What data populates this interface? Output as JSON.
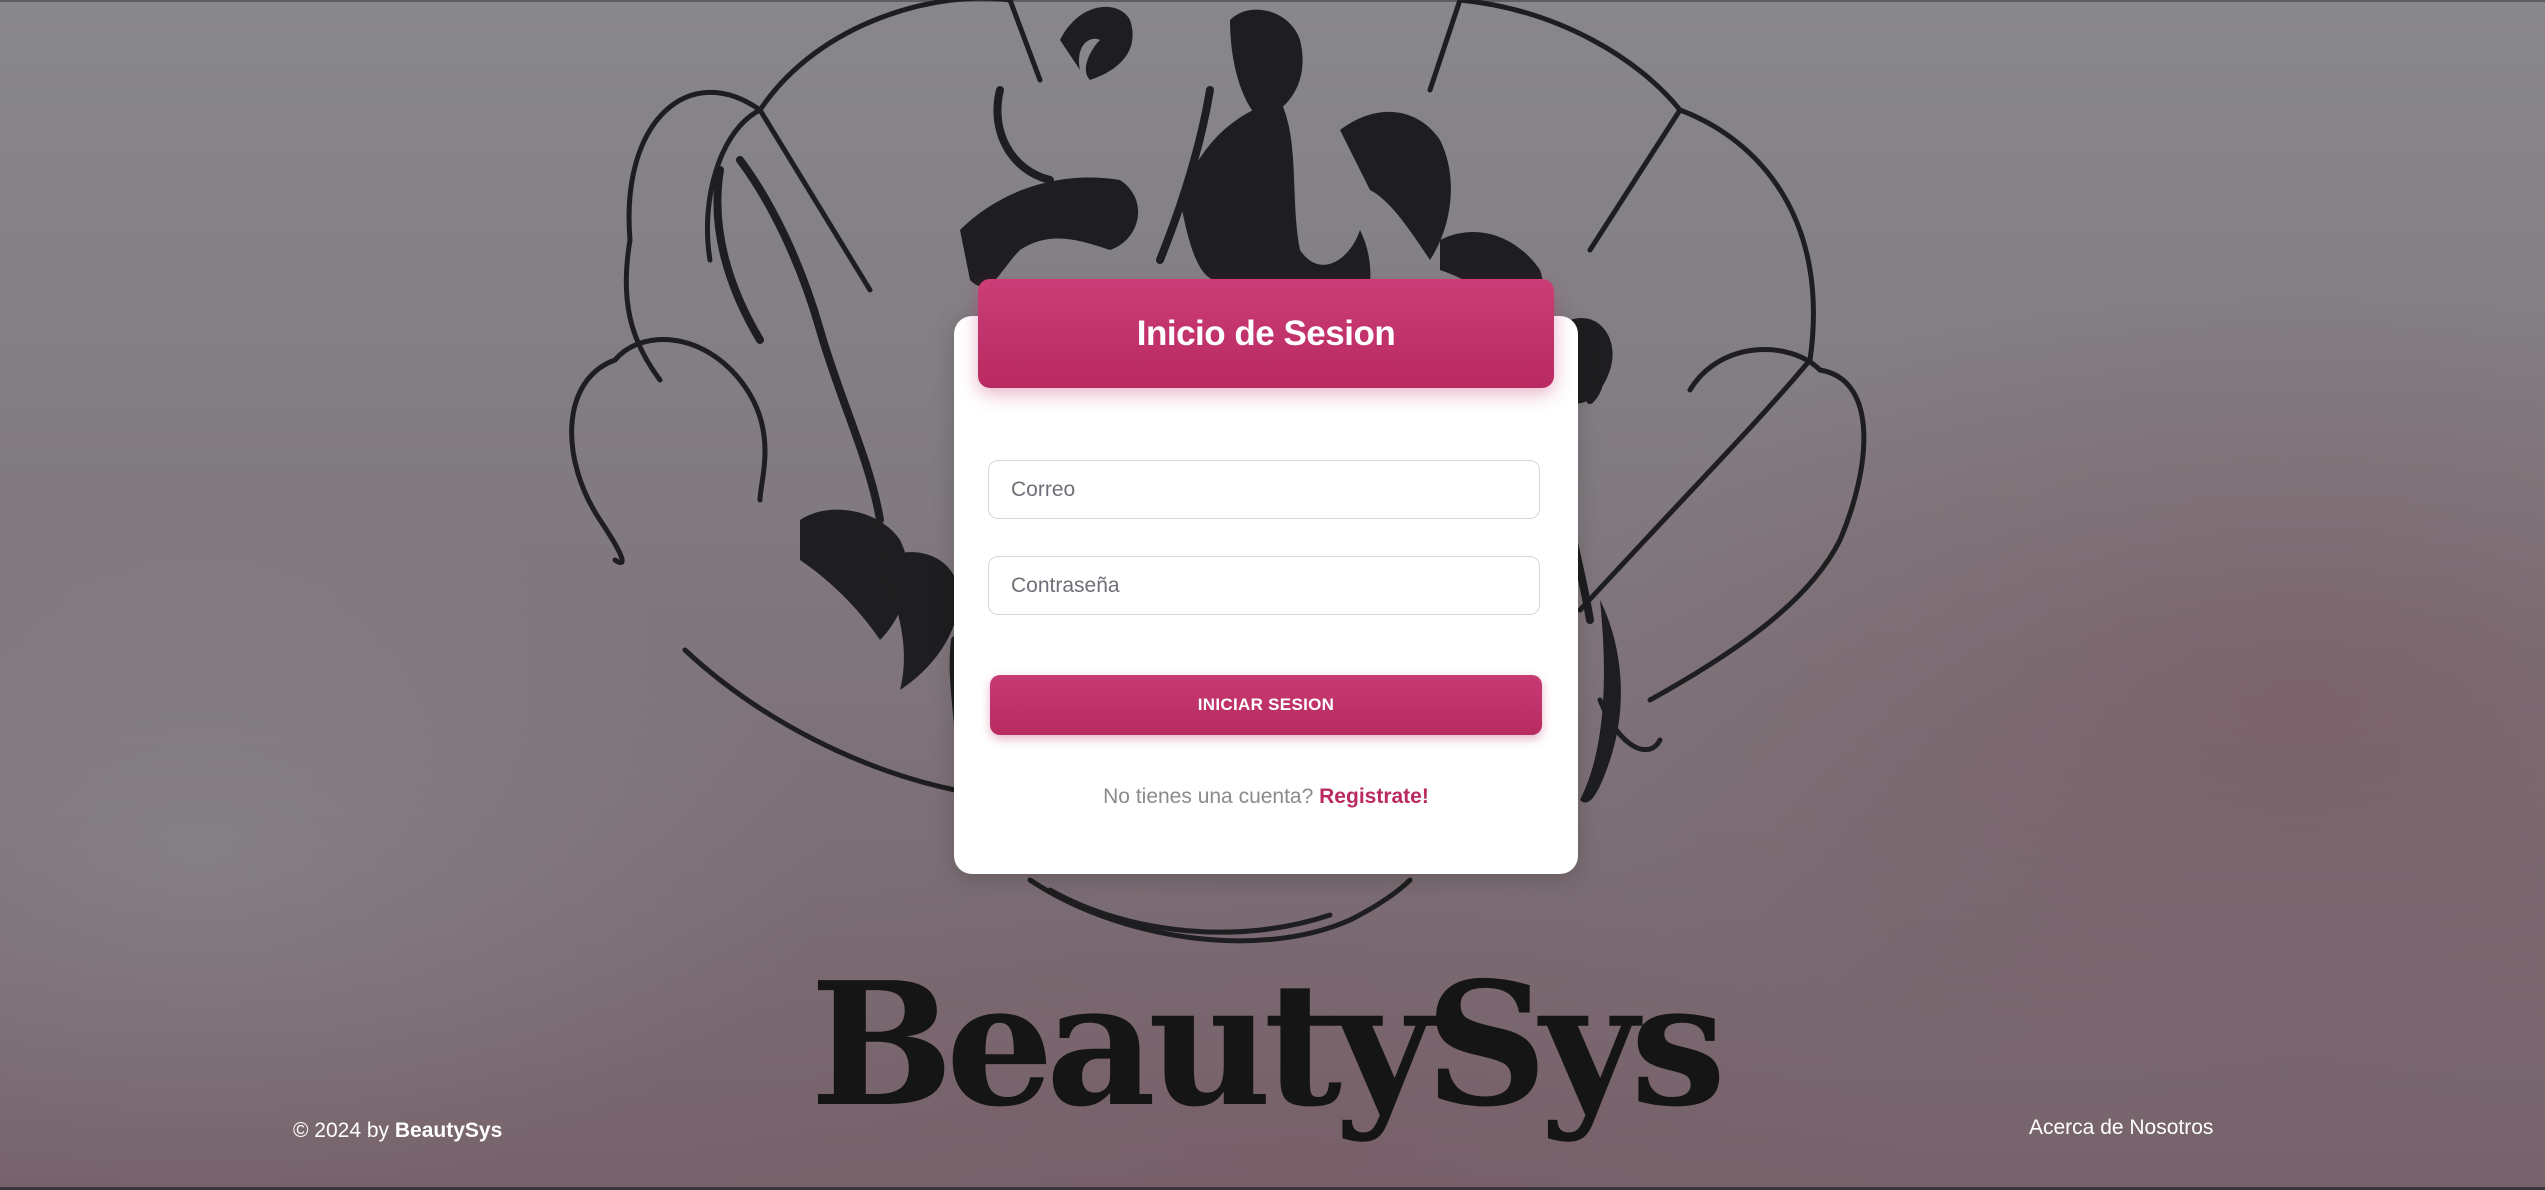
{
  "login": {
    "title": "Inicio de Sesion",
    "email_placeholder": "Correo",
    "password_placeholder": "Contraseña",
    "submit_label": "INICIAR SESION",
    "register_prompt": "No tienes una cuenta?",
    "register_link": "Registrate!"
  },
  "brand": {
    "wordmark": "BeautySys"
  },
  "footer": {
    "copyright_prefix": "© 2024 by",
    "copyright_brand": "BeautySys",
    "about_link": "Acerca de Nosotros"
  },
  "colors": {
    "accent": "#b82a60",
    "accent_light": "#cc3d77",
    "card_bg": "#ffffff",
    "brand_text": "#151515"
  },
  "icons": {
    "background_logo": "woman-silhouette-shell-logo"
  }
}
